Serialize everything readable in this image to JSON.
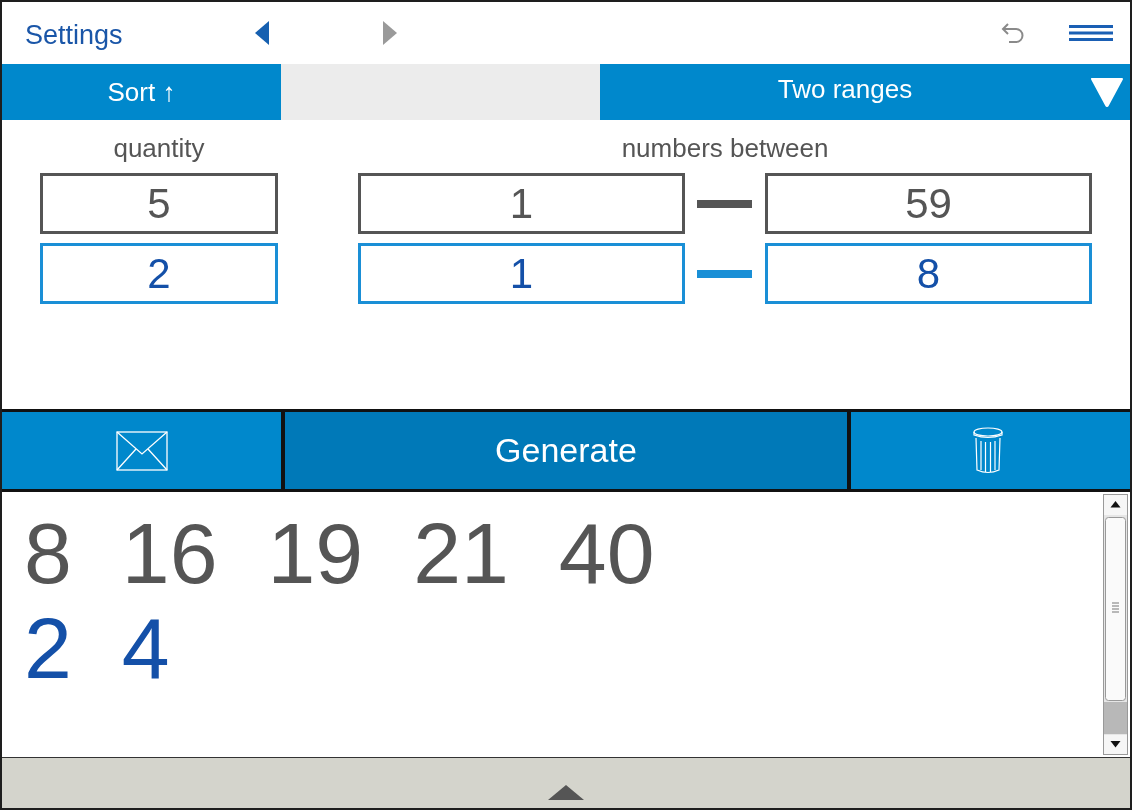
{
  "header": {
    "title": "Settings",
    "nav_buttons": [
      {
        "kind": "back",
        "disabled": false
      },
      {
        "kind": "forward",
        "disabled": true
      }
    ]
  },
  "toolbar": {
    "sort_button": {
      "label": "Sort ↑"
    },
    "mode_dropdown": {
      "value": "Two ranges"
    }
  },
  "form": {
    "quantity_label": "quantity",
    "range_label": "numbers between",
    "rows": [
      {
        "kind": "main",
        "quantity": "5",
        "from": "1",
        "to": "59"
      },
      {
        "kind": "bonus",
        "quantity": "2",
        "from": "1",
        "to": "8"
      }
    ]
  },
  "actions": [
    {
      "kind": "email"
    },
    {
      "kind": "generate",
      "label": "Generate"
    },
    {
      "kind": "trash"
    }
  ],
  "results": {
    "rows": [
      {
        "kind": "main",
        "numbers": [
          "8",
          "16",
          "19",
          "21",
          "40"
        ]
      },
      {
        "kind": "bonus",
        "numbers": [
          "2",
          "4"
        ]
      }
    ]
  }
}
